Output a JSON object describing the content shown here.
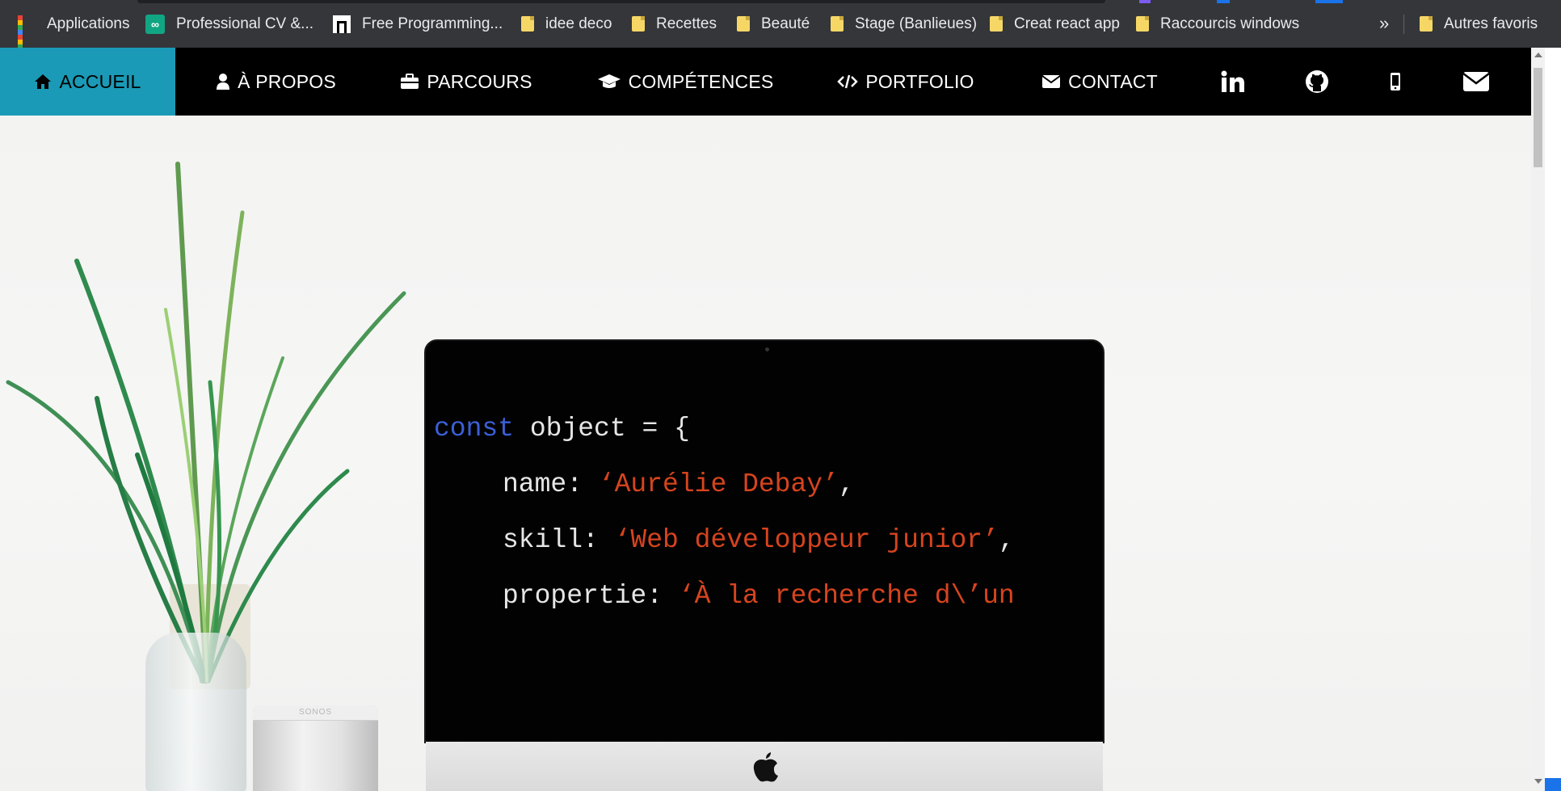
{
  "bookmarks": {
    "items": [
      {
        "label": "Applications",
        "icon": "apps-grid-icon"
      },
      {
        "label": "Professional CV &...",
        "icon": "cv-site-icon"
      },
      {
        "label": "Free Programming...",
        "icon": "freecodecamp-icon"
      },
      {
        "label": "idee deco",
        "icon": "folder-icon"
      },
      {
        "label": "Recettes",
        "icon": "folder-icon"
      },
      {
        "label": "Beauté",
        "icon": "folder-icon"
      },
      {
        "label": "Stage (Banlieues)",
        "icon": "folder-icon"
      },
      {
        "label": "Creat react app",
        "icon": "folder-icon"
      },
      {
        "label": "Raccourcis windows",
        "icon": "folder-icon"
      }
    ],
    "more": "»",
    "other": "Autres favoris"
  },
  "nav": {
    "items": [
      {
        "label": "ACCUEIL",
        "icon": "home-icon",
        "active": true
      },
      {
        "label": "À PROPOS",
        "icon": "user-icon"
      },
      {
        "label": "PARCOURS",
        "icon": "briefcase-icon"
      },
      {
        "label": "COMPÉTENCES",
        "icon": "graduation-cap-icon"
      },
      {
        "label": "PORTFOLIO",
        "icon": "code-icon"
      },
      {
        "label": "CONTACT",
        "icon": "envelope-icon"
      }
    ],
    "social": [
      "linkedin-icon",
      "github-icon",
      "mobile-phone-icon",
      "envelope-icon"
    ],
    "colors": {
      "bar": "#000000",
      "active": "#1a9ab6"
    }
  },
  "hero": {
    "code": {
      "line1_kw": "const",
      "line1_rest": " object = {",
      "line2_key": "name: ",
      "line2_val": "‘Aurélie Debay’",
      "line2_end": ",",
      "line3_key": "skill: ",
      "line3_val": "‘Web développeur junior’",
      "line3_end": ",",
      "line4_key": "propertie: ",
      "line4_val": "‘À la recherche d\\’un"
    },
    "speaker_brand": "SONOS",
    "colors": {
      "keyword": "#3b5fd6",
      "string": "#d7441e",
      "text": "#e6e6e6"
    }
  }
}
